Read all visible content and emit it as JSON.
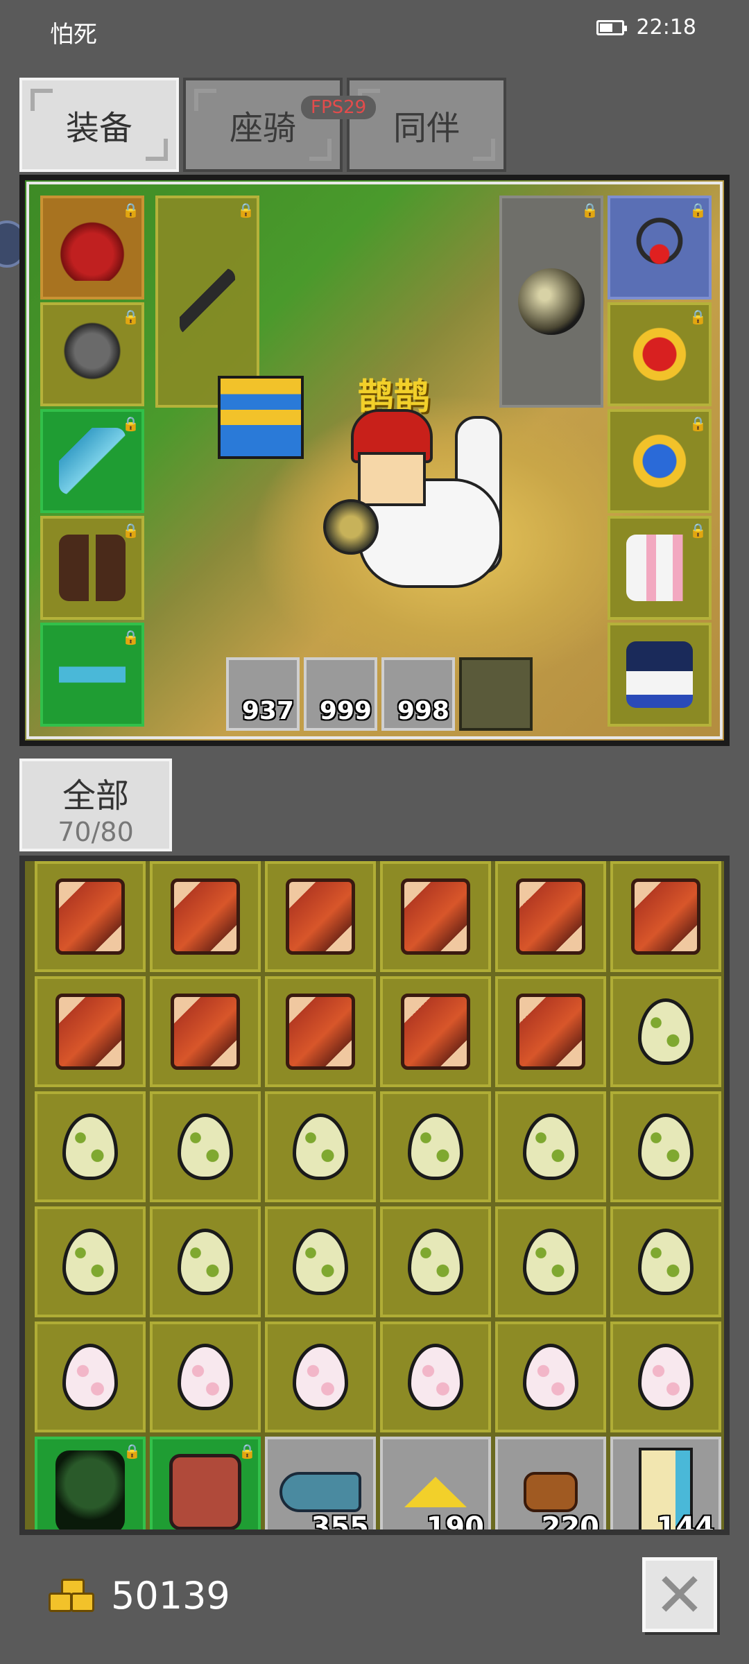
{
  "status_bar": {
    "app_name": "怕死",
    "time": "22:18"
  },
  "tabs": [
    {
      "label": "装备",
      "active": true
    },
    {
      "label": "座骑",
      "active": false
    },
    {
      "label": "同伴",
      "active": false
    }
  ],
  "fps_badge": "FPS29",
  "scene": {
    "character_name": "鹊鹊",
    "counts": [
      "937",
      "999",
      "998"
    ]
  },
  "filter": {
    "label": "全部",
    "capacity": "70/80"
  },
  "inventory": {
    "row6_counts": [
      "355",
      "190",
      "220",
      "144"
    ]
  },
  "gold": {
    "value": "50139"
  },
  "colors": {
    "background": "#5a5a5a",
    "slot_olive": "#8d8b25",
    "slot_green": "#1f9d33",
    "name_yellow": "#f2d02a"
  }
}
